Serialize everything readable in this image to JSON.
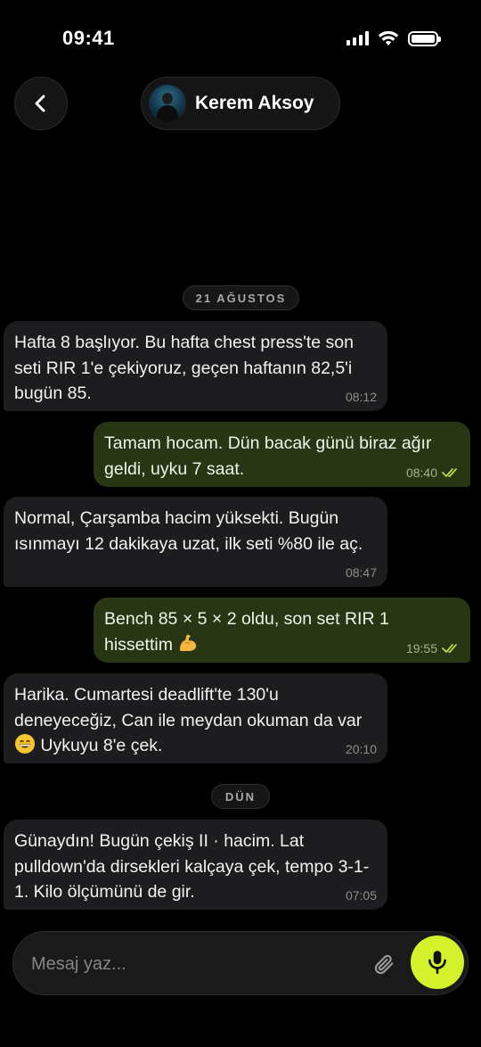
{
  "status_bar": {
    "time": "09:41",
    "battery_level": 1.0
  },
  "header": {
    "contact_name": "Kerem Aksoy"
  },
  "dividers": [
    {
      "label": "21 AĞUSTOS"
    },
    {
      "label": "DÜN"
    }
  ],
  "messages": [
    {
      "direction": "incoming",
      "text": "Hafta 8 başlıyor. Bu hafta chest press'te son seti RIR 1'e çekiyoruz, geçen haftanın 82,5'i bugün 85.",
      "time": "08:12"
    },
    {
      "direction": "outgoing",
      "text": "Tamam hocam. Dün bacak günü biraz ağır geldi, uyku 7 saat.",
      "time": "08:40",
      "status": "read"
    },
    {
      "direction": "incoming",
      "text": "Normal, Çarşamba hacim yüksekti. Bugün ısınmayı 12 dakikaya uzat, ilk seti %80 ile aç.",
      "time": "08:47"
    },
    {
      "direction": "outgoing",
      "text_before_emoji": "Bench 85 × 5 × 2 oldu, son set RIR 1 hissettim",
      "emoji": "flexed-biceps",
      "time": "19:55",
      "status": "read"
    },
    {
      "direction": "incoming",
      "text_before_emoji": "Harika. Cumartesi deadlift'te 130'u deneyeceğiz, Can ile meydan okuman da var",
      "emoji": "grinning-face",
      "text_after_emoji": "Uykuyu 8'e çek.",
      "time": "20:10"
    },
    {
      "direction": "incoming",
      "text": "Günaydın! Bugün çekiş II · hacim. Lat pulldown'da dirsekleri kalçaya çek, tempo 3-1-1. Kilo ölçümünü de gir.",
      "time": "07:05"
    }
  ],
  "composer": {
    "placeholder": "Mesaj yaz..."
  },
  "colors": {
    "background": "#000000",
    "incoming_bubble": "#1d1d1f",
    "outgoing_bubble": "#283614",
    "accent": "#d4f22c",
    "read_ticks": "#b9d84a"
  },
  "icons": {
    "back": "chevron-left-icon",
    "attach": "paperclip-icon",
    "mic": "microphone-icon",
    "signal": "cellular-signal-icon",
    "wifi": "wifi-icon",
    "battery": "battery-icon",
    "read": "double-check-icon"
  }
}
